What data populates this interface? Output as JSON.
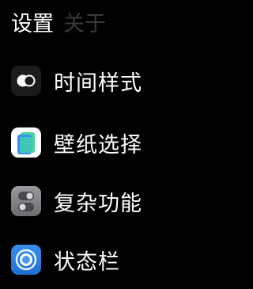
{
  "tabs": {
    "settings_label": "设置",
    "about_label": "关于",
    "active_color": "#ffffff",
    "inactive_color": "#3a3a3a"
  },
  "menu": {
    "items": [
      {
        "label": "时间样式",
        "icon": "time-style-icon"
      },
      {
        "label": "壁纸选择",
        "icon": "wallpaper-icon"
      },
      {
        "label": "复杂功能",
        "icon": "complications-icon"
      },
      {
        "label": "状态栏",
        "icon": "status-bar-icon"
      }
    ]
  }
}
